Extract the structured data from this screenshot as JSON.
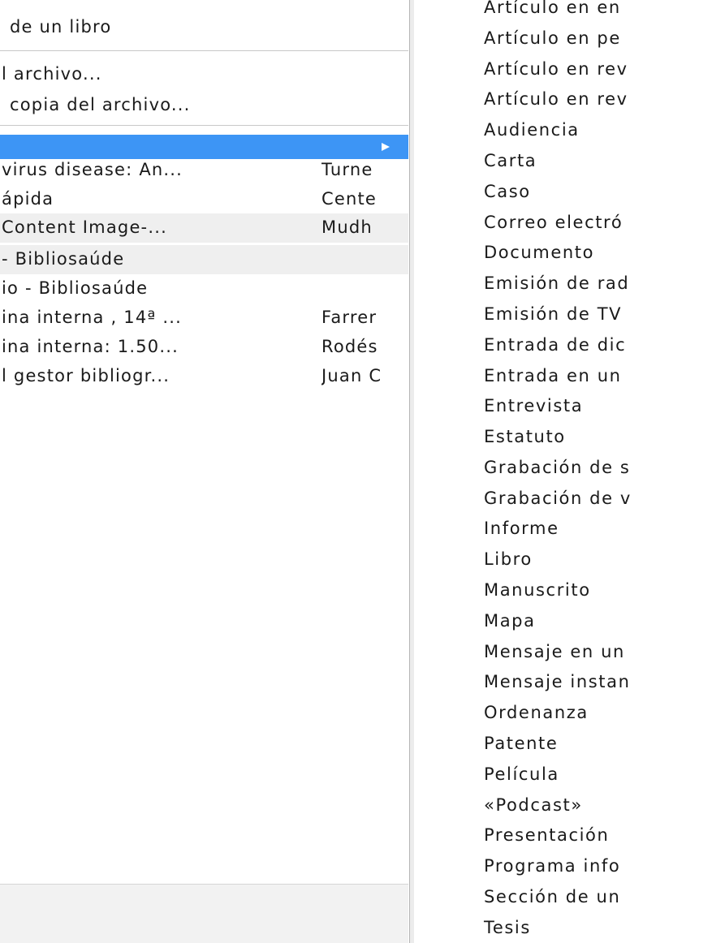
{
  "left_menu": {
    "items": [
      {
        "label": "de un libro"
      },
      {
        "label": "l archivo..."
      },
      {
        "label": "copia del archivo..."
      }
    ]
  },
  "items_list": {
    "rows": [
      {
        "title": "virus disease: An...",
        "creator": "Turne"
      },
      {
        "title": "ápida",
        "creator": "Cente"
      },
      {
        "title": "Content Image-...",
        "creator": "Mudh"
      },
      {
        "title": "- Bibliosaúde",
        "creator": ""
      },
      {
        "title": "io - Bibliosaúde",
        "creator": ""
      },
      {
        "title": "ina interna , 14ª ...",
        "creator": "Farrer"
      },
      {
        "title": "ina interna: 1.50...",
        "creator": "Rodés"
      },
      {
        "title": "l gestor bibliogr...",
        "creator": "Juan C"
      }
    ]
  },
  "item_types": {
    "items": [
      {
        "label": "Artículo en en"
      },
      {
        "label": "Artículo en pe"
      },
      {
        "label": "Artículo en rev"
      },
      {
        "label": "Artículo en rev"
      },
      {
        "label": "Audiencia"
      },
      {
        "label": "Carta"
      },
      {
        "label": "Caso"
      },
      {
        "label": "Correo electró"
      },
      {
        "label": "Documento"
      },
      {
        "label": "Emisión de rad"
      },
      {
        "label": "Emisión de TV"
      },
      {
        "label": "Entrada de dic"
      },
      {
        "label": "Entrada en un"
      },
      {
        "label": "Entrevista"
      },
      {
        "label": "Estatuto"
      },
      {
        "label": "Grabación de s"
      },
      {
        "label": "Grabación de v"
      },
      {
        "label": "Informe"
      },
      {
        "label": "Libro"
      },
      {
        "label": "Manuscrito"
      },
      {
        "label": "Mapa"
      },
      {
        "label": "Mensaje en un"
      },
      {
        "label": "Mensaje instan"
      },
      {
        "label": "Ordenanza"
      },
      {
        "label": "Patente"
      },
      {
        "label": "Película"
      },
      {
        "label": "«Podcast»"
      },
      {
        "label": "Presentación"
      },
      {
        "label": "Programa info"
      },
      {
        "label": "Sección de un"
      },
      {
        "label": "Tesis"
      }
    ]
  },
  "colors": {
    "highlight": "#3d95f5",
    "row_alt": "#efefef"
  },
  "icons": {
    "submenu": "triangle-right-icon"
  }
}
